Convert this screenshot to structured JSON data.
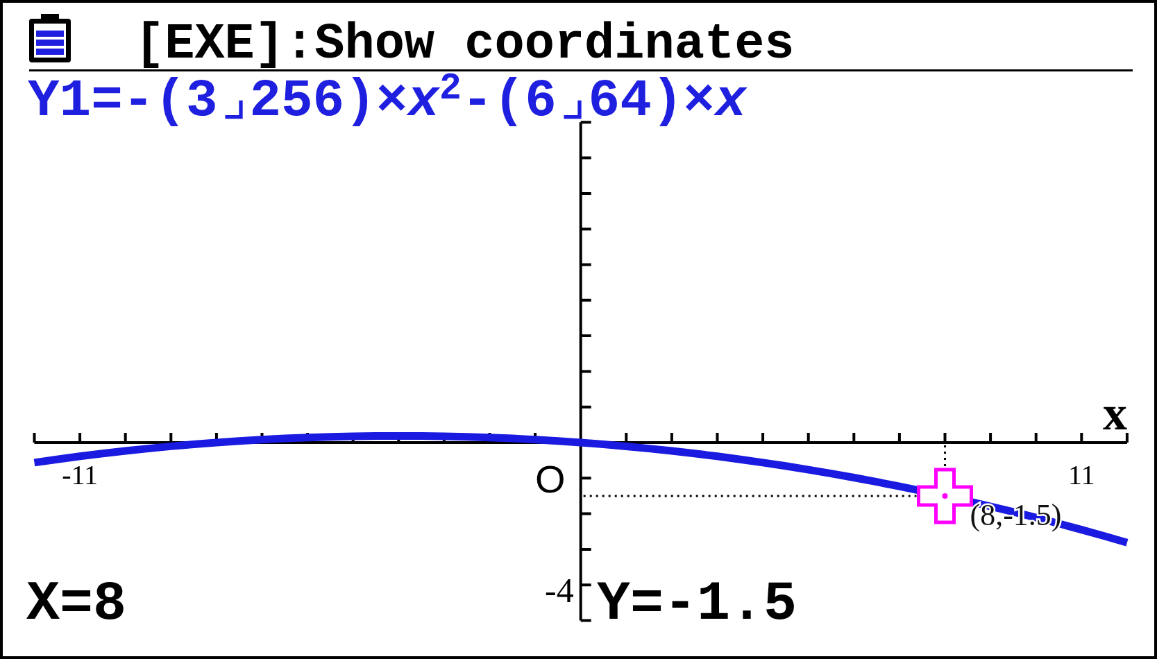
{
  "screen": {
    "title": "[EXE]:Show coordinates"
  },
  "graph": {
    "formula": "Y1=-(3⌟256)×*x*$^{2}$-(6⌟64)×*x*",
    "x_axis_label": "x",
    "x_tick_labels": [
      "-11",
      "11"
    ],
    "origin_label": "O",
    "y_tick_label": "-4",
    "point_label": "(8,-1.5)"
  },
  "readout": {
    "x": "X=8",
    "y": "Y=-1.5"
  }
}
